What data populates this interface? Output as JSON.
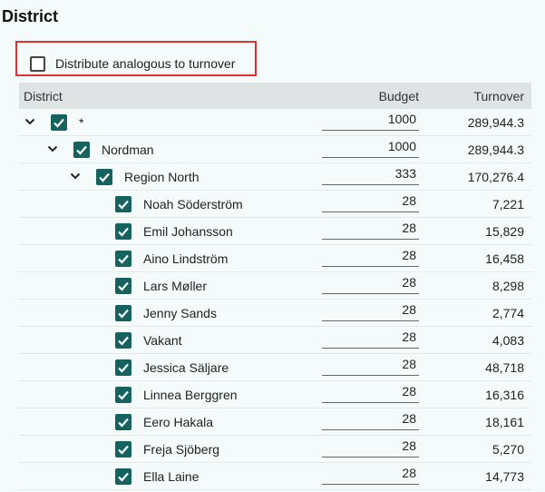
{
  "title": "District",
  "distribute": {
    "label": "Distribute analogous to turnover",
    "checked": false
  },
  "columns": {
    "district": "District",
    "budget": "Budget",
    "turnover": "Turnover"
  },
  "rows": [
    {
      "name": "*",
      "budget": "1000",
      "turnover": "289,944.3",
      "level": 0,
      "expandable": true,
      "checked": true
    },
    {
      "name": "Nordman",
      "budget": "1000",
      "turnover": "289,944.3",
      "level": 1,
      "expandable": true,
      "checked": true
    },
    {
      "name": "Region North",
      "budget": "333",
      "turnover": "170,276.4",
      "level": 2,
      "expandable": true,
      "checked": true
    },
    {
      "name": "Noah Söderström",
      "budget": "28",
      "turnover": "7,221",
      "level": 3,
      "expandable": false,
      "checked": true
    },
    {
      "name": "Emil Johansson",
      "budget": "28",
      "turnover": "15,829",
      "level": 3,
      "expandable": false,
      "checked": true
    },
    {
      "name": "Aino Lindström",
      "budget": "28",
      "turnover": "16,458",
      "level": 3,
      "expandable": false,
      "checked": true
    },
    {
      "name": "Lars Møller",
      "budget": "28",
      "turnover": "8,298",
      "level": 3,
      "expandable": false,
      "checked": true
    },
    {
      "name": "Jenny Sands",
      "budget": "28",
      "turnover": "2,774",
      "level": 3,
      "expandable": false,
      "checked": true
    },
    {
      "name": "Vakant",
      "budget": "28",
      "turnover": "4,083",
      "level": 3,
      "expandable": false,
      "checked": true
    },
    {
      "name": "Jessica Säljare",
      "budget": "28",
      "turnover": "48,718",
      "level": 3,
      "expandable": false,
      "checked": true
    },
    {
      "name": "Linnea Berggren",
      "budget": "28",
      "turnover": "16,316",
      "level": 3,
      "expandable": false,
      "checked": true
    },
    {
      "name": "Eero Hakala",
      "budget": "28",
      "turnover": "18,161",
      "level": 3,
      "expandable": false,
      "checked": true
    },
    {
      "name": "Freja Sjöberg",
      "budget": "28",
      "turnover": "5,270",
      "level": 3,
      "expandable": false,
      "checked": true
    },
    {
      "name": "Ella Laine",
      "budget": "28",
      "turnover": "14,773",
      "level": 3,
      "expandable": false,
      "checked": true
    }
  ],
  "colors": {
    "checkbox": "#16625e",
    "highlight_border": "#e03131",
    "header_bg": "#dfe3e3"
  }
}
